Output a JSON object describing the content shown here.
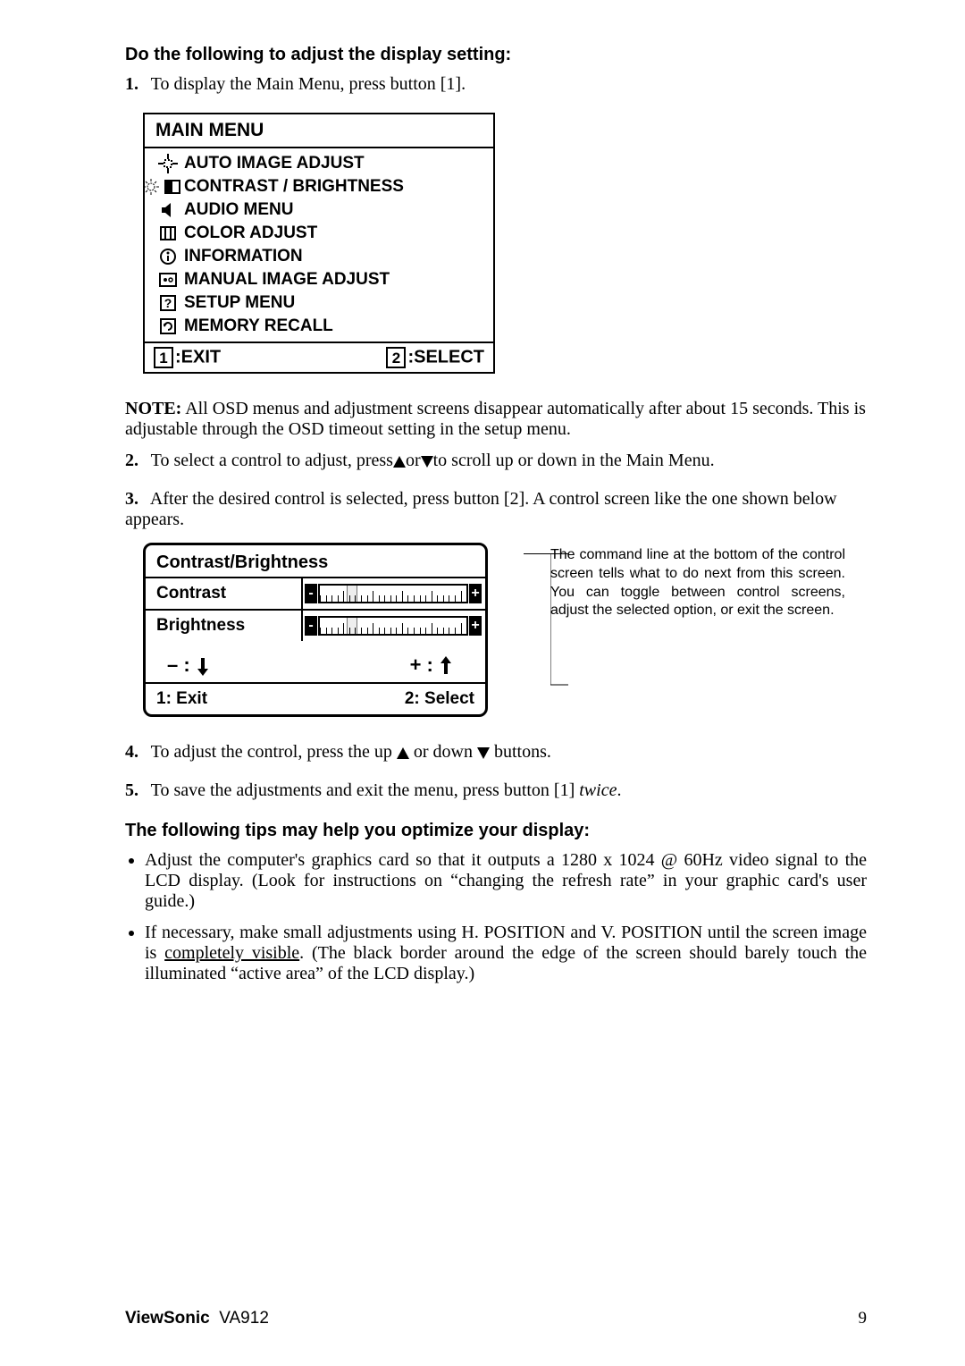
{
  "section1_heading": "Do the following to adjust the display setting:",
  "step1_num": "1.",
  "step1_text": "To display the Main Menu, press button [1].",
  "mainmenu": {
    "title": "MAIN MENU",
    "items": [
      "AUTO IMAGE ADJUST",
      "CONTRAST / BRIGHTNESS",
      "AUDIO MENU",
      "COLOR ADJUST",
      "INFORMATION",
      "MANUAL IMAGE ADJUST",
      "SETUP MENU",
      "MEMORY RECALL"
    ],
    "footer_key1": "1",
    "footer_label1": ":EXIT",
    "footer_key2": "2",
    "footer_label2": ":SELECT"
  },
  "note_prefix": "NOTE:",
  "note_text": " All OSD menus and adjustment screens disappear automatically after about 15 seconds. This is adjustable through the OSD timeout setting in the setup menu.",
  "step2_num": "2.",
  "step2_a": "To select a control to adjust, press",
  "step2_b": "or",
  "step2_c": "to scroll up or down in the Main Menu.",
  "step3_num": "3.",
  "step3_text": "After the desired control is selected, press button [2]. A control screen like the one shown below appears.",
  "control": {
    "title": "Contrast/Brightness",
    "row1_label": "Contrast",
    "row2_label": "Brightness",
    "arrows_left": "–",
    "arrows_right": "+",
    "foot_left": "1: Exit",
    "foot_right": "2: Select"
  },
  "callout_text": "The command line at the bottom of the control screen tells what to do next from this screen. You can toggle between control screens, adjust the selected option, or exit the screen.",
  "step4_num": "4.",
  "step4_a": "To adjust the control, press the up ",
  "step4_b": " or down ",
  "step4_c": " buttons.",
  "step5_num": "5.",
  "step5_a": "To save the adjustments and exit the menu, press button [1] ",
  "step5_twice": "twice",
  "step5_b": ".",
  "section2_heading": "The following tips may help you optimize your display:",
  "bullets": [
    "Adjust the computer's graphics card so that it outputs a 1280 x 1024 @ 60Hz video signal to the LCD display. (Look for instructions on “changing the refresh rate” in your graphic card's user guide.)",
    "If necessary, make small adjustments using H. POSITION and V. POSITION until the screen image is "
  ],
  "bullet2_u": "completely visible",
  "bullet2_tail": ". (The black border around the edge of the screen should barely touch the illuminated “active area” of the LCD display.)",
  "footer_brand": "ViewSonic",
  "footer_model": "VA912",
  "footer_page": "9"
}
